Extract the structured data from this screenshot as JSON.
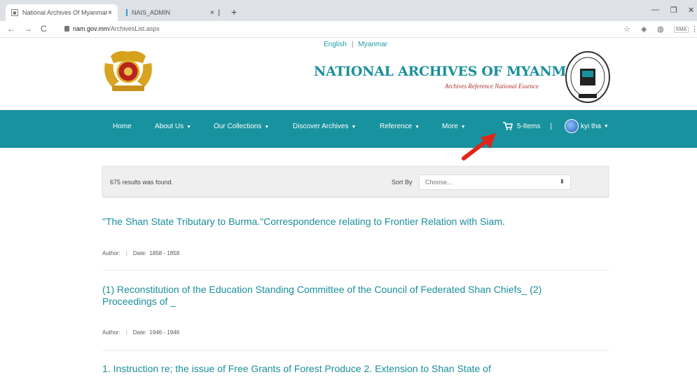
{
  "browser": {
    "tabs": [
      {
        "title": "National Archives Of Myanmar",
        "active": true
      },
      {
        "title": "NAIS_ADMIN",
        "active": false
      }
    ],
    "url_host": "nam.gov.mm",
    "url_path": "/ArchivesList.aspx"
  },
  "header": {
    "lang_english": "English",
    "lang_sep": "|",
    "lang_myanmar": "Myanmar",
    "title": "NATIONAL ARCHIVES OF MYANMAR",
    "subtitle": "Archives Reference National Essence"
  },
  "nav": {
    "items": [
      {
        "label": "Home",
        "dropdown": false
      },
      {
        "label": "About Us",
        "dropdown": true
      },
      {
        "label": "Our Collections",
        "dropdown": true
      },
      {
        "label": "Discover Archives",
        "dropdown": true
      },
      {
        "label": "Reference",
        "dropdown": true
      },
      {
        "label": "More",
        "dropdown": true
      }
    ],
    "cart_label": "5-Items",
    "user_sep": "|",
    "user_name": "kyi tha"
  },
  "results": {
    "count_text": "675 results was found.",
    "sort_label": "Sort By",
    "sort_value": "Choose..."
  },
  "records": [
    {
      "title": "\"The Shan State Tributary to Burma.\"Correspondence relating to Frontier Relation with Siam.",
      "author_label": "Author:",
      "date_label": "Date:",
      "date": "1858 - 1858"
    },
    {
      "title": "(1) Reconstitution of the Education Standing Committee of the Council of Federated Shan Chiefs_ (2) Proceedings of _",
      "author_label": "Author:",
      "date_label": "Date:",
      "date": "1946 - 1946"
    },
    {
      "title": "1. Instruction re; the issue of Free Grants of Forest Produce 2. Extension to Shan State of",
      "author_label": "",
      "date_label": "",
      "date": ""
    }
  ],
  "colors": {
    "teal": "#18929e",
    "link": "#1a8f9b",
    "arrow": "#e0261b"
  }
}
